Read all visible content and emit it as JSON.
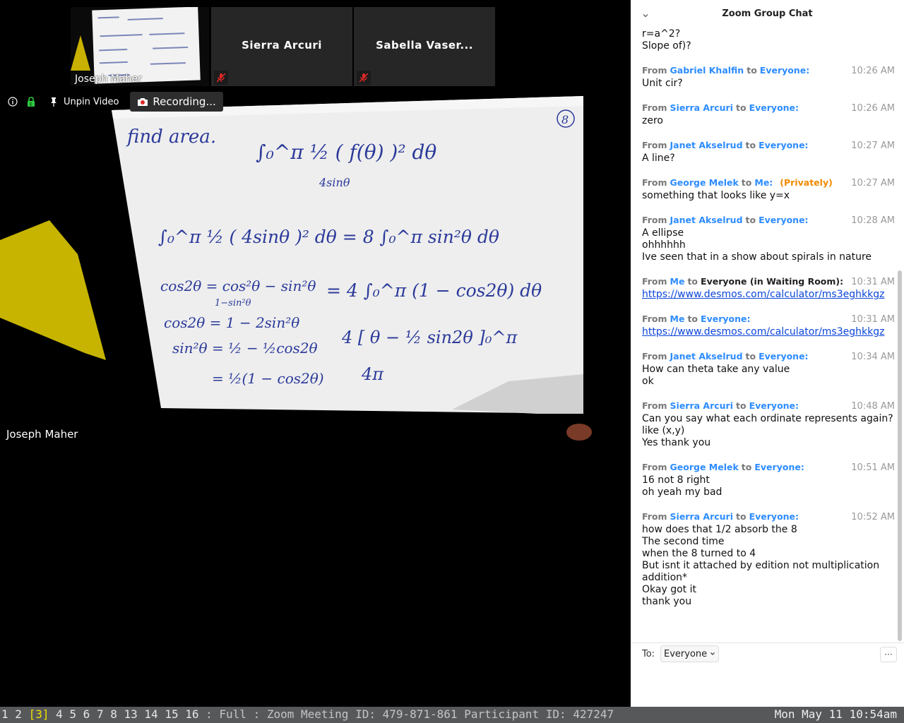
{
  "meeting": {
    "thumbnails": [
      {
        "name": "Joseph Maher"
      },
      {
        "name": "Sierra Arcuri"
      },
      {
        "name": "Sabella Vaser..."
      }
    ],
    "toolbar": {
      "unpin_label": "Unpin Video",
      "recording_label": "Recording..."
    },
    "main_video_name": "Joseph Maher",
    "whiteboard": {
      "title": "find area.",
      "page_mark": "8",
      "lines": [
        "∫₀^π ½ ( f(θ) )² dθ",
        "4sinθ",
        "∫₀^π ½ ( 4sinθ )² dθ =   8 ∫₀^π sin²θ dθ",
        "cos2θ = cos²θ − sin²θ",
        "1−sin²θ",
        "= 4 ∫₀^π (1 − cos2θ) dθ",
        "cos2θ = 1 − 2sin²θ",
        "sin²θ = ½ − ½cos2θ",
        "4 [ θ − ½ sin2θ ]₀^π",
        "= ½(1 − cos2θ)",
        "4π"
      ]
    }
  },
  "chat": {
    "title": "Zoom Group Chat",
    "from_label": "From",
    "to_label": "to",
    "messages": [
      {
        "sender": "",
        "recipient": "",
        "time": "",
        "lines": [
          "r=a^2?",
          "Slope of)?"
        ]
      },
      {
        "sender": "Gabriel Khalfin",
        "recipient": "Everyone:",
        "time": "10:26 AM",
        "lines": [
          "Unit cir?"
        ]
      },
      {
        "sender": "Sierra Arcuri",
        "recipient": "Everyone:",
        "time": "10:26 AM",
        "lines": [
          "zero"
        ]
      },
      {
        "sender": "Janet Akselrud",
        "recipient": "Everyone:",
        "time": "10:27 AM",
        "lines": [
          "A line?"
        ]
      },
      {
        "sender": "George Melek",
        "recipient": "Me:",
        "private": "(Privately)",
        "time": "10:27 AM",
        "lines": [
          "something that looks like y=x"
        ]
      },
      {
        "sender": "Janet Akselrud",
        "recipient": "Everyone:",
        "time": "10:28 AM",
        "lines": [
          "A ellipse",
          "ohhhhhh",
          "Ive seen that in a show about spirals in nature"
        ]
      },
      {
        "sender": "Me",
        "recipient": "Everyone (in Waiting Room):",
        "recipient_dark": true,
        "time": "10:31 AM",
        "link": "https://www.desmos.com/calculator/ms3eghkkgz"
      },
      {
        "sender": "Me",
        "recipient": "Everyone:",
        "time": "10:31 AM",
        "link": "https://www.desmos.com/calculator/ms3eghkkgz"
      },
      {
        "sender": "Janet Akselrud",
        "recipient": "Everyone:",
        "time": "10:34 AM",
        "lines": [
          "How can theta take any value",
          "ok"
        ]
      },
      {
        "sender": "Sierra Arcuri",
        "recipient": "Everyone:",
        "time": "10:48 AM",
        "lines": [
          "Can you say what each ordinate represents again?",
          "like (x,y)",
          "Yes thank you"
        ]
      },
      {
        "sender": "George Melek",
        "recipient": "Everyone:",
        "time": "10:51 AM",
        "lines": [
          "16 not 8 right",
          "oh yeah my bad"
        ]
      },
      {
        "sender": "Sierra Arcuri",
        "recipient": "Everyone:",
        "time": "10:52 AM",
        "lines": [
          "how does that 1/2 absorb the 8",
          "The second time",
          "when the 8 turned to 4",
          "But isnt it attached by edition not multiplication",
          "addition*",
          "Okay got it",
          "thank you"
        ]
      }
    ],
    "composer": {
      "to_label": "To:",
      "recipient": "Everyone",
      "more_label": "···"
    }
  },
  "statusbar": {
    "workspaces": [
      "1",
      "2",
      "[3]",
      "4",
      "5",
      "6",
      "7",
      "8",
      "13",
      "14",
      "15",
      "16"
    ],
    "active_workspace": "[3]",
    "info": ": Full : Zoom Meeting ID: 479-871-861 Participant ID: 427247",
    "clock": "Mon May 11 10:54am"
  },
  "colors": {
    "accent": "#2d8cff",
    "private": "#f08a00",
    "link": "#0b45d9",
    "whiteboard_ink": "#2b3a9a",
    "statusbar_bg": "#57585a",
    "active_workspace": "#f0e000"
  }
}
